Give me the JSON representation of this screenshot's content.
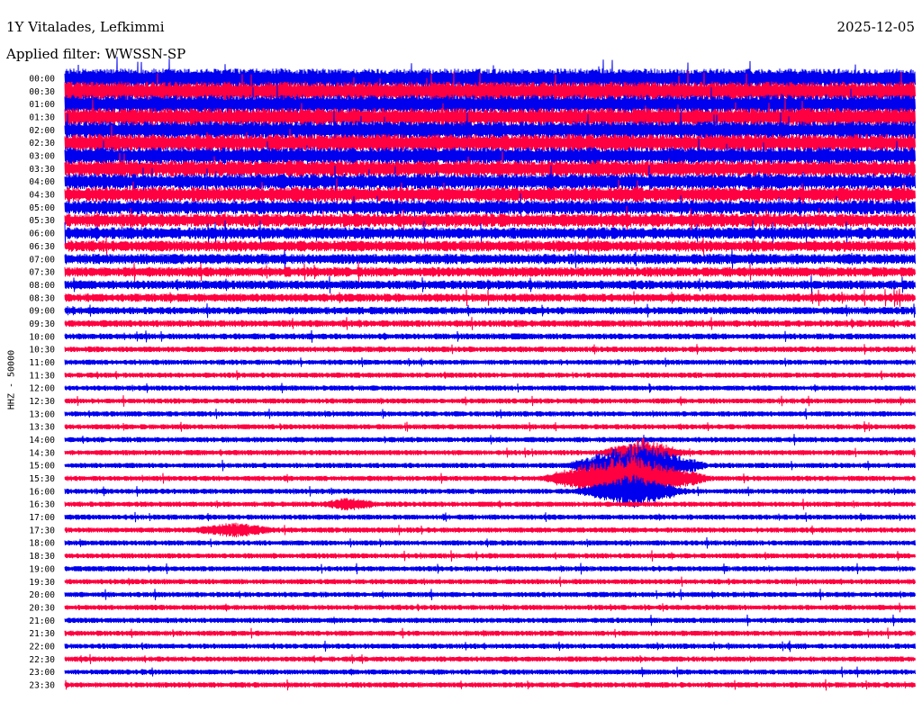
{
  "header": {
    "station": "1Y Vitalades, Lefkimmi",
    "date": "2025-12-05",
    "filter": "Applied filter: WWSSN-SP"
  },
  "chart_data": {
    "type": "line",
    "title": "1Y Vitalades, Lefkimmi",
    "ylabel": "HHZ - 50000",
    "xlabel": "",
    "row_labels": [
      "00:00",
      "00:30",
      "01:00",
      "01:30",
      "02:00",
      "02:30",
      "03:00",
      "03:30",
      "04:00",
      "04:30",
      "05:00",
      "05:30",
      "06:00",
      "06:30",
      "07:00",
      "07:30",
      "08:00",
      "08:30",
      "09:00",
      "09:30",
      "10:00",
      "10:30",
      "11:00",
      "11:30",
      "12:00",
      "12:30",
      "13:00",
      "13:30",
      "14:00",
      "14:30",
      "15:00",
      "15:30",
      "16:00",
      "16:30",
      "17:00",
      "17:30",
      "18:00",
      "18:30",
      "19:00",
      "19:30",
      "20:00",
      "20:30",
      "21:00",
      "21:30",
      "22:00",
      "22:30",
      "23:00",
      "23:30"
    ],
    "series_colors": [
      "#0000ee",
      "#ff0040"
    ],
    "noise_level": [
      2.6,
      2.6,
      2.5,
      2.4,
      2.4,
      2.3,
      2.3,
      2.2,
      2.1,
      2.0,
      1.9,
      1.8,
      1.6,
      1.5,
      1.4,
      1.3,
      1.2,
      1.1,
      1.0,
      0.9,
      0.8,
      0.75,
      0.7,
      0.7,
      0.7,
      0.7,
      0.7,
      0.7,
      0.7,
      0.7,
      0.7,
      0.7,
      0.7,
      0.7,
      0.7,
      0.7,
      0.7,
      0.7,
      0.7,
      0.7,
      0.7,
      0.7,
      0.7,
      0.7,
      0.7,
      0.7,
      0.7,
      0.7
    ],
    "events": [
      {
        "row": 29,
        "minute": 20.4,
        "amplitude": 3.0,
        "duration_min": 1.5
      },
      {
        "row": 30,
        "minute": 20.2,
        "amplitude": 5.0,
        "duration_min": 2.5
      },
      {
        "row": 31,
        "minute": 19.8,
        "amplitude": 5.5,
        "duration_min": 3.0
      },
      {
        "row": 32,
        "minute": 20.0,
        "amplitude": 3.5,
        "duration_min": 2.0
      },
      {
        "row": 35,
        "minute": 6.0,
        "amplitude": 1.4,
        "duration_min": 1.5
      },
      {
        "row": 33,
        "minute": 10.0,
        "amplitude": 1.3,
        "duration_min": 1.0
      }
    ]
  }
}
